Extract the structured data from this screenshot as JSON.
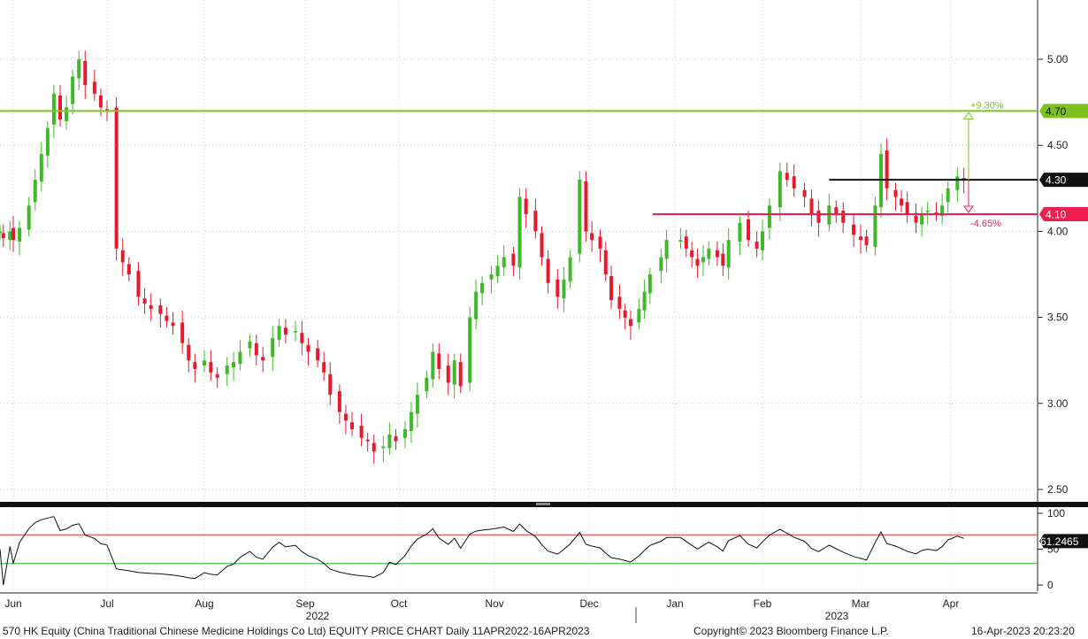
{
  "colors": {
    "up": "#3fb928",
    "down": "#e8192c",
    "resistance": "#7cc11e",
    "support": "#ef1e4f",
    "current": "#111111",
    "rsi_line": "#111111",
    "rsi_overbought": "#e0302f",
    "rsi_oversold": "#27b227",
    "grid": "#c8c8c8"
  },
  "chart_data": [
    {
      "type": "candlestick",
      "title": "",
      "ylim": [
        2.45,
        5.32
      ],
      "y_ticks": [
        "5.00",
        "4.50",
        "4.00",
        "3.50",
        "3.00",
        "2.50"
      ],
      "x_ticks": [
        "Jun",
        "Jul",
        "Aug",
        "Sep",
        "Oct",
        "Nov",
        "Dec",
        "Jan",
        "Feb",
        "Mar",
        "Apr"
      ],
      "x_year_labels": [
        "2022",
        "2023"
      ],
      "series": [
        {
          "values": [
            {
              "date": "2022-05-24",
              "close": 4.0
            },
            {
              "date": "2022-05-26",
              "close": 3.96
            },
            {
              "date": "2022-05-30",
              "close": 4.0
            },
            {
              "date": "2022-06-01",
              "close": 3.95
            },
            {
              "date": "2022-06-03",
              "close": 4.02
            },
            {
              "date": "2022-06-06",
              "close": 4.15
            },
            {
              "date": "2022-06-08",
              "close": 4.3
            },
            {
              "date": "2022-06-10",
              "close": 4.45
            },
            {
              "date": "2022-06-12",
              "close": 4.6
            },
            {
              "date": "2022-06-14",
              "close": 4.8
            },
            {
              "date": "2022-06-16",
              "close": 4.65
            },
            {
              "date": "2022-06-18",
              "close": 4.72
            },
            {
              "date": "2022-06-20",
              "close": 4.9
            },
            {
              "date": "2022-06-22",
              "close": 5.0
            },
            {
              "date": "2022-06-24",
              "close": 4.85
            },
            {
              "date": "2022-06-27",
              "close": 4.8
            },
            {
              "date": "2022-06-29",
              "close": 4.72
            },
            {
              "date": "2022-07-01",
              "close": 4.7
            },
            {
              "date": "2022-07-04",
              "close": 3.9
            },
            {
              "date": "2022-07-06",
              "close": 3.82
            },
            {
              "date": "2022-07-08",
              "close": 3.75
            },
            {
              "date": "2022-07-11",
              "close": 3.62
            },
            {
              "date": "2022-07-13",
              "close": 3.58
            },
            {
              "date": "2022-07-15",
              "close": 3.55
            },
            {
              "date": "2022-07-18",
              "close": 3.52
            },
            {
              "date": "2022-07-20",
              "close": 3.48
            },
            {
              "date": "2022-07-22",
              "close": 3.45
            },
            {
              "date": "2022-07-25",
              "close": 3.35
            },
            {
              "date": "2022-07-27",
              "close": 3.25
            },
            {
              "date": "2022-07-29",
              "close": 3.2
            },
            {
              "date": "2022-08-01",
              "close": 3.25
            },
            {
              "date": "2022-08-03",
              "close": 3.18
            },
            {
              "date": "2022-08-05",
              "close": 3.15
            },
            {
              "date": "2022-08-08",
              "close": 3.22
            },
            {
              "date": "2022-08-10",
              "close": 3.24
            },
            {
              "date": "2022-08-12",
              "close": 3.3
            },
            {
              "date": "2022-08-15",
              "close": 3.36
            },
            {
              "date": "2022-08-17",
              "close": 3.28
            },
            {
              "date": "2022-08-19",
              "close": 3.25
            },
            {
              "date": "2022-08-22",
              "close": 3.38
            },
            {
              "date": "2022-08-24",
              "close": 3.45
            },
            {
              "date": "2022-08-26",
              "close": 3.4
            },
            {
              "date": "2022-08-29",
              "close": 3.42
            },
            {
              "date": "2022-08-31",
              "close": 3.35
            },
            {
              "date": "2022-09-02",
              "close": 3.3
            },
            {
              "date": "2022-09-05",
              "close": 3.25
            },
            {
              "date": "2022-09-07",
              "close": 3.18
            },
            {
              "date": "2022-09-09",
              "close": 3.05
            },
            {
              "date": "2022-09-12",
              "close": 2.95
            },
            {
              "date": "2022-09-14",
              "close": 2.9
            },
            {
              "date": "2022-09-16",
              "close": 2.85
            },
            {
              "date": "2022-09-19",
              "close": 2.8
            },
            {
              "date": "2022-09-21",
              "close": 2.78
            },
            {
              "date": "2022-09-23",
              "close": 2.72
            },
            {
              "date": "2022-09-26",
              "close": 2.75
            },
            {
              "date": "2022-09-28",
              "close": 2.82
            },
            {
              "date": "2022-09-30",
              "close": 2.78
            },
            {
              "date": "2022-10-03",
              "close": 2.85
            },
            {
              "date": "2022-10-05",
              "close": 2.95
            },
            {
              "date": "2022-10-07",
              "close": 3.05
            },
            {
              "date": "2022-10-10",
              "close": 3.15
            },
            {
              "date": "2022-10-12",
              "close": 3.3
            },
            {
              "date": "2022-10-14",
              "close": 3.2
            },
            {
              "date": "2022-10-17",
              "close": 3.12
            },
            {
              "date": "2022-10-19",
              "close": 3.25
            },
            {
              "date": "2022-10-21",
              "close": 3.1
            },
            {
              "date": "2022-10-24",
              "close": 3.5
            },
            {
              "date": "2022-10-26",
              "close": 3.65
            },
            {
              "date": "2022-10-28",
              "close": 3.7
            },
            {
              "date": "2022-10-31",
              "close": 3.75
            },
            {
              "date": "2022-11-02",
              "close": 3.8
            },
            {
              "date": "2022-11-04",
              "close": 3.85
            },
            {
              "date": "2022-11-07",
              "close": 3.8
            },
            {
              "date": "2022-11-09",
              "close": 4.2
            },
            {
              "date": "2022-11-11",
              "close": 4.1
            },
            {
              "date": "2022-11-14",
              "close": 4.0
            },
            {
              "date": "2022-11-16",
              "close": 3.85
            },
            {
              "date": "2022-11-18",
              "close": 3.7
            },
            {
              "date": "2022-11-21",
              "close": 3.62
            },
            {
              "date": "2022-11-23",
              "close": 3.72
            },
            {
              "date": "2022-11-25",
              "close": 3.85
            },
            {
              "date": "2022-11-28",
              "close": 4.3
            },
            {
              "date": "2022-11-30",
              "close": 4.0
            },
            {
              "date": "2022-12-02",
              "close": 3.95
            },
            {
              "date": "2022-12-05",
              "close": 3.9
            },
            {
              "date": "2022-12-07",
              "close": 3.75
            },
            {
              "date": "2022-12-09",
              "close": 3.6
            },
            {
              "date": "2022-12-12",
              "close": 3.55
            },
            {
              "date": "2022-12-14",
              "close": 3.5
            },
            {
              "date": "2022-12-16",
              "close": 3.45
            },
            {
              "date": "2022-12-19",
              "close": 3.55
            },
            {
              "date": "2022-12-21",
              "close": 3.65
            },
            {
              "date": "2022-12-23",
              "close": 3.75
            },
            {
              "date": "2022-12-27",
              "close": 3.85
            },
            {
              "date": "2022-12-29",
              "close": 3.95
            },
            {
              "date": "2023-01-03",
              "close": 3.95
            },
            {
              "date": "2023-01-05",
              "close": 3.9
            },
            {
              "date": "2023-01-07",
              "close": 3.85
            },
            {
              "date": "2023-01-09",
              "close": 3.8
            },
            {
              "date": "2023-01-11",
              "close": 3.85
            },
            {
              "date": "2023-01-13",
              "close": 3.9
            },
            {
              "date": "2023-01-16",
              "close": 3.85
            },
            {
              "date": "2023-01-18",
              "close": 3.8
            },
            {
              "date": "2023-01-20",
              "close": 3.95
            },
            {
              "date": "2023-01-24",
              "close": 4.05
            },
            {
              "date": "2023-01-27",
              "close": 3.95
            },
            {
              "date": "2023-01-30",
              "close": 3.9
            },
            {
              "date": "2023-02-01",
              "close": 4.0
            },
            {
              "date": "2023-02-03",
              "close": 4.15
            },
            {
              "date": "2023-02-06",
              "close": 4.35
            },
            {
              "date": "2023-02-08",
              "close": 4.3
            },
            {
              "date": "2023-02-10",
              "close": 4.25
            },
            {
              "date": "2023-02-13",
              "close": 4.2
            },
            {
              "date": "2023-02-15",
              "close": 4.1
            },
            {
              "date": "2023-02-17",
              "close": 4.05
            },
            {
              "date": "2023-02-20",
              "close": 4.15
            },
            {
              "date": "2023-02-22",
              "close": 4.1
            },
            {
              "date": "2023-02-24",
              "close": 4.05
            },
            {
              "date": "2023-02-27",
              "close": 3.98
            },
            {
              "date": "2023-03-01",
              "close": 3.95
            },
            {
              "date": "2023-03-03",
              "close": 3.92
            },
            {
              "date": "2023-03-06",
              "close": 4.15
            },
            {
              "date": "2023-03-08",
              "close": 4.45
            },
            {
              "date": "2023-03-10",
              "close": 4.25
            },
            {
              "date": "2023-03-13",
              "close": 4.2
            },
            {
              "date": "2023-03-15",
              "close": 4.15
            },
            {
              "date": "2023-03-17",
              "close": 4.1
            },
            {
              "date": "2023-03-20",
              "close": 4.05
            },
            {
              "date": "2023-03-22",
              "close": 4.1
            },
            {
              "date": "2023-03-24",
              "close": 4.12
            },
            {
              "date": "2023-03-27",
              "close": 4.1
            },
            {
              "date": "2023-03-29",
              "close": 4.15
            },
            {
              "date": "2023-03-31",
              "close": 4.25
            },
            {
              "date": "2023-04-03",
              "close": 4.32
            },
            {
              "date": "2023-04-05",
              "close": 4.3
            }
          ]
        }
      ],
      "annotations": [
        {
          "label": "4.70",
          "value": 4.7,
          "change": "+9.30%"
        },
        {
          "label": "4.30",
          "value": 4.3
        },
        {
          "label": "4.10",
          "value": 4.1,
          "change": "-4.65%"
        }
      ]
    },
    {
      "type": "line",
      "title": "",
      "ylim": [
        -5,
        105
      ],
      "y_ticks": [
        "100",
        "50",
        "0"
      ],
      "reference_lines": [
        70,
        30
      ],
      "last_value_label": "61.2465"
    }
  ],
  "footer": {
    "left": "570 HK Equity (China Traditional Chinese Medicine Holdings Co Ltd) EQUITY PRICE CHART  Daily 11APR2022-16APR2023",
    "center": "Copyright© 2023 Bloomberg Finance L.P.",
    "right": "16-Apr-2023 20:23:20"
  }
}
